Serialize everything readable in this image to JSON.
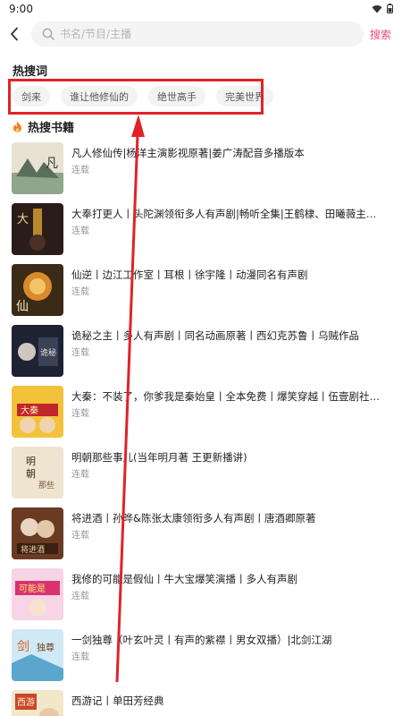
{
  "status_bar": {
    "time": "9:00",
    "wifi_icon": "wifi-icon",
    "battery_icon": "battery-icon"
  },
  "header": {
    "back_icon": "back-arrow-icon",
    "search_icon": "search-icon",
    "search_placeholder": "书名/节目/主播",
    "search_value": "",
    "search_button": "搜索",
    "accent_color": "#f04a7e"
  },
  "hot_words": {
    "title": "热搜词",
    "items": [
      "剑来",
      "谁让他修仙的",
      "绝世高手",
      "完美世界"
    ]
  },
  "hot_books": {
    "title": "热搜书籍",
    "flame_icon": "flame-icon",
    "items": [
      {
        "title": "凡人修仙传|杨洋主演影视原著|姜广涛配音多播版本",
        "status": "连载"
      },
      {
        "title": "大奉打更人丨头陀渊领衔多人有声剧|畅听全集|王鹤棣、田曦薇主…",
        "status": "连载"
      },
      {
        "title": "仙逆丨边江工作室丨耳根丨徐宇隆丨动漫同名有声剧",
        "status": "连载"
      },
      {
        "title": "诡秘之主丨多人有声剧丨同名动画原著丨西幻克苏鲁丨乌贼作品",
        "status": "连载"
      },
      {
        "title": "大秦：不装了，你爹我是秦始皇丨全本免费丨爆笑穿越丨伍壹剧社…",
        "status": "连载"
      },
      {
        "title": "明朝那些事儿(当年明月著 王更新播讲)",
        "status": "连载"
      },
      {
        "title": "将进酒丨孙晔&陈张太康领衔多人有声剧丨唐酒卿原著",
        "status": "连载"
      },
      {
        "title": "我修的可能是假仙丨牛大宝爆笑演播丨多人有声剧",
        "status": "连载"
      },
      {
        "title": "一剑独尊（叶玄叶灵丨有声的紫襟丨男女双播）|北剑江湖",
        "status": "连载"
      },
      {
        "title": "西游记丨单田芳经典",
        "status": ""
      }
    ]
  }
}
